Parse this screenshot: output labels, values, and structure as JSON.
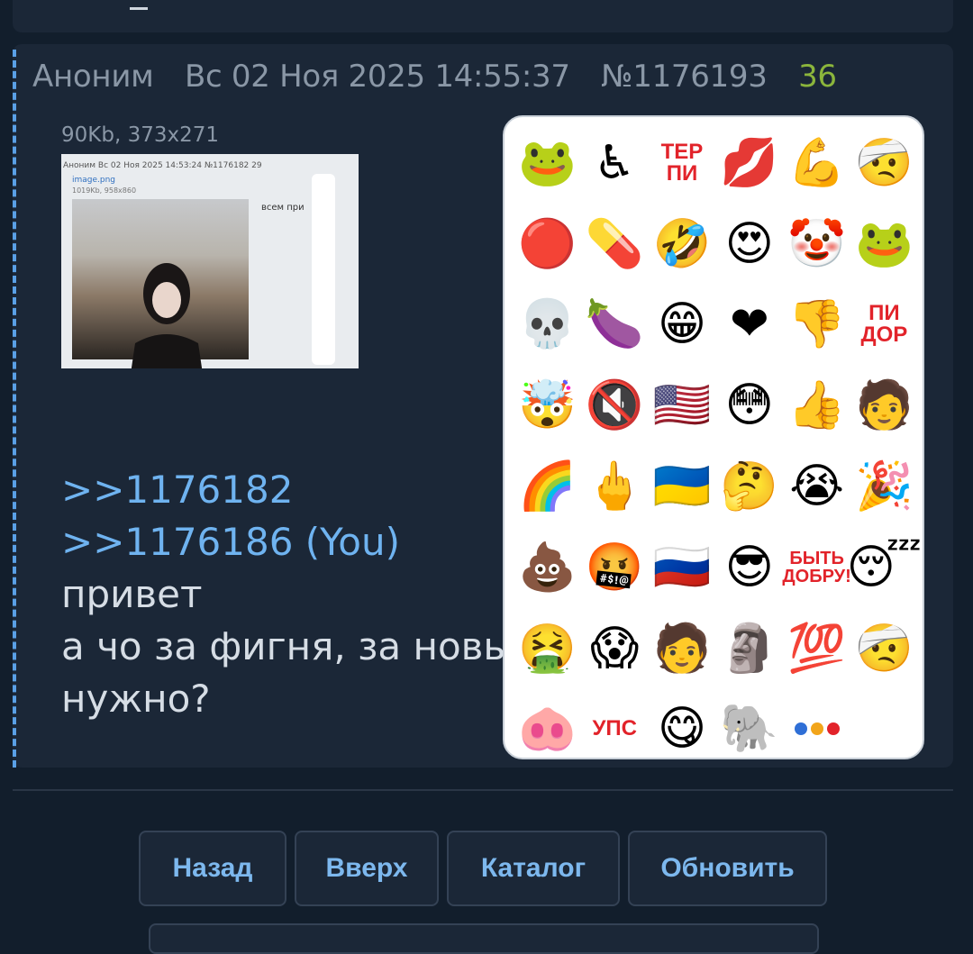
{
  "post": {
    "author": "Аноним",
    "date": "Вс 02 Ноя 2025 14:55:37",
    "number": "№1176193",
    "replies": "36",
    "file_info": "90Kb, 373x271",
    "thumb": {
      "header": "Аноним  Вс 02 Ноя 2025 14:53:24 №1176182 29",
      "filename": "image.png",
      "size": "1019Kb, 958x860",
      "text": "всем при"
    },
    "links": [
      ">>1176182",
      ">>1176186 (You)"
    ],
    "lines": [
      "привет",
      "а чо за фигня, за новые",
      "нужно?"
    ]
  },
  "emoji_panel": {
    "items": [
      {
        "name": "pepe-icon",
        "glyph": "🐸"
      },
      {
        "name": "wheelchair-icon",
        "glyph": "♿"
      },
      {
        "name": "terpi-sticker",
        "text": "ТЕР\nПИ"
      },
      {
        "name": "kiss-icon",
        "glyph": "💋"
      },
      {
        "name": "muscle-icon",
        "glyph": "💪"
      },
      {
        "name": "paper-face-icon",
        "glyph": "🤕"
      },
      {
        "name": "hh-icon",
        "glyph": "🔴"
      },
      {
        "name": "pill-icon",
        "glyph": "💊"
      },
      {
        "name": "rofl-icon",
        "glyph": "🤣"
      },
      {
        "name": "heart-eyes-icon",
        "glyph": "😍"
      },
      {
        "name": "clown-icon",
        "glyph": "🤡"
      },
      {
        "name": "copium-pepe-icon",
        "glyph": "🐸"
      },
      {
        "name": "skull-icon",
        "glyph": "💀"
      },
      {
        "name": "eggplant-icon",
        "glyph": "🍆"
      },
      {
        "name": "grin-icon",
        "glyph": "😁"
      },
      {
        "name": "heart-icon",
        "glyph": "❤"
      },
      {
        "name": "thumbs-down-icon",
        "glyph": "👎"
      },
      {
        "name": "pidor-sticker",
        "text": "ПИ\nДОР"
      },
      {
        "name": "exploding-head-icon",
        "glyph": "🤯"
      },
      {
        "name": "mute-icon",
        "glyph": "🔇"
      },
      {
        "name": "us-flag-icon",
        "glyph": "🇺🇸"
      },
      {
        "name": "flushed-icon",
        "glyph": "😳"
      },
      {
        "name": "thumbs-up-icon",
        "glyph": "👍"
      },
      {
        "name": "face-photo-icon",
        "glyph": "🧑"
      },
      {
        "name": "rainbow-icon",
        "glyph": "🌈"
      },
      {
        "name": "middle-finger-icon",
        "glyph": "🖕"
      },
      {
        "name": "ua-flag-icon",
        "glyph": "🇺🇦"
      },
      {
        "name": "thinking-icon",
        "glyph": "🤔"
      },
      {
        "name": "crying-icon",
        "glyph": "😭"
      },
      {
        "name": "party-popper-icon",
        "glyph": "🎉"
      },
      {
        "name": "poop-icon",
        "glyph": "💩"
      },
      {
        "name": "cursing-icon",
        "glyph": "🤬"
      },
      {
        "name": "ru-flag-icon",
        "glyph": "🇷🇺"
      },
      {
        "name": "sunglasses-icon",
        "glyph": "😎"
      },
      {
        "name": "byt-dobru-sticker",
        "text": "БЫТЬ\nДОБРУ!"
      },
      {
        "name": "sleeping-icon",
        "glyph": "😴"
      },
      {
        "name": "vomiting-icon",
        "glyph": "🤮"
      },
      {
        "name": "soyjak-icon",
        "glyph": "😱"
      },
      {
        "name": "putin-face-icon",
        "glyph": "🧑"
      },
      {
        "name": "moai-icon",
        "glyph": "🗿"
      },
      {
        "name": "hundred-icon",
        "glyph": "💯"
      },
      {
        "name": "paper-face-2-icon",
        "glyph": "🤕"
      },
      {
        "name": "pig-nose-icon",
        "glyph": "🐽"
      },
      {
        "name": "ups-sticker",
        "text": "УПС"
      },
      {
        "name": "yum-icon",
        "glyph": "😋"
      },
      {
        "name": "elephant-icon",
        "glyph": "🐘"
      },
      {
        "name": "more-dots-icon",
        "dots": [
          "#2f6fd6",
          "#f2a51a",
          "#e2232a"
        ]
      }
    ]
  },
  "nav": {
    "back": "Назад",
    "top": "Вверх",
    "catalog": "Каталог",
    "refresh": "Обновить"
  }
}
